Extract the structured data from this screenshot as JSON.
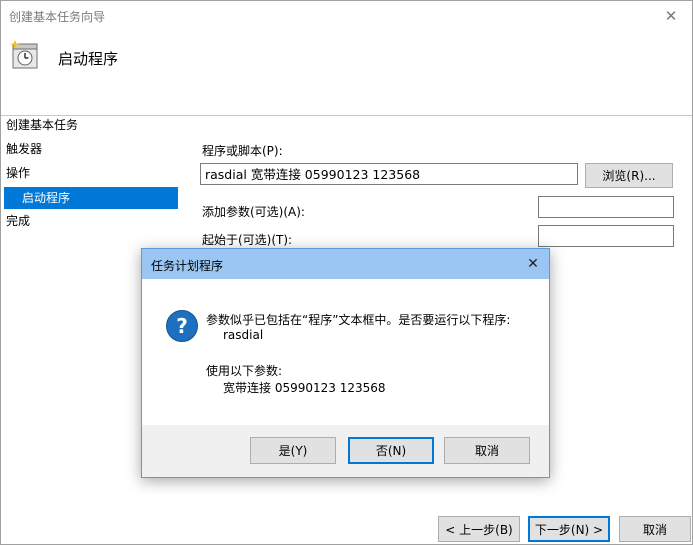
{
  "window": {
    "title": "创建基本任务向导",
    "close_glyph": "✕",
    "header_title": "启动程序"
  },
  "nav": {
    "items": [
      {
        "label": "创建基本任务"
      },
      {
        "label": "触发器"
      },
      {
        "label": "操作"
      },
      {
        "label": "启动程序"
      },
      {
        "label": "完成"
      }
    ]
  },
  "form": {
    "program_label": "程序或脚本(P):",
    "program_value": "rasdial 宽带连接 05990123 123568",
    "browse_label": "浏览(R)...",
    "args_label": "添加参数(可选)(A):",
    "args_value": "",
    "start_in_label": "起始于(可选)(T):",
    "start_in_value": ""
  },
  "footer": {
    "back_label": "< 上一步(B)",
    "next_label": "下一步(N) >",
    "cancel_label": "取消"
  },
  "dialog": {
    "title": "任务计划程序",
    "close_glyph": "✕",
    "message_line1": "参数似乎已包括在“程序”文本框中。是否要运行以下程序:",
    "program": "rasdial",
    "args_intro": "使用以下参数:",
    "args": "宽带连接 05990123 123568",
    "question_glyph": "?",
    "yes_label": "是(Y)",
    "no_label": "否(N)",
    "cancel_label": "取消"
  },
  "colors": {
    "selection": "#0078d7",
    "dialog_titlebar": "#9bc6f3",
    "question_icon": "#1e6fbf"
  }
}
